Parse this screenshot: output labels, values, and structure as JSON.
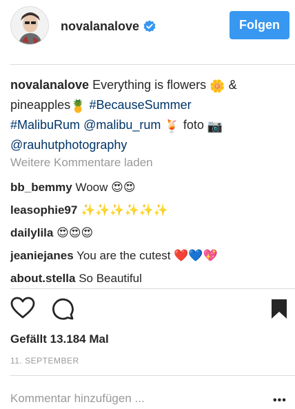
{
  "header": {
    "username": "novalanalove",
    "follow_label": "Folgen",
    "accent_color": "#3897f0"
  },
  "caption": {
    "username": "novalanalove",
    "text_1": "Everything is flowers",
    "text_2": "&",
    "text_3": "pineapples",
    "hashtag_1": "#BecauseSummer",
    "hashtag_2": "#MalibuRum",
    "mention_1": "@malibu_rum",
    "text_4": "foto",
    "mention_2": "@rauhutphotography",
    "emoji_flower": "🌼",
    "emoji_pineapple": "🍍",
    "emoji_drink": "🍹",
    "emoji_camera": "📷"
  },
  "load_more_label": "Weitere Kommentare laden",
  "comments": [
    {
      "user": "bb_bemmy",
      "text": "Woow",
      "emojis": "😍😍"
    },
    {
      "user": "leasophie97",
      "text": "",
      "emojis": "✨✨✨✨✨✨"
    },
    {
      "user": "dailylila",
      "text": "",
      "emojis": "😍😍😍"
    },
    {
      "user": "jeaniejanes",
      "text": "You are the cutest",
      "emojis": "❤️💙💖"
    },
    {
      "user": "about.stella",
      "text": "So Beautiful",
      "emojis": ""
    }
  ],
  "likes_label": "Gefällt 13.184 Mal",
  "date_label": "11. SEPTEMBER",
  "comment_placeholder": "Kommentar hinzufügen ...",
  "more_label": "•••",
  "icons": [
    "heart-icon",
    "comment-icon",
    "bookmark-icon",
    "verified-icon",
    "more-icon"
  ]
}
